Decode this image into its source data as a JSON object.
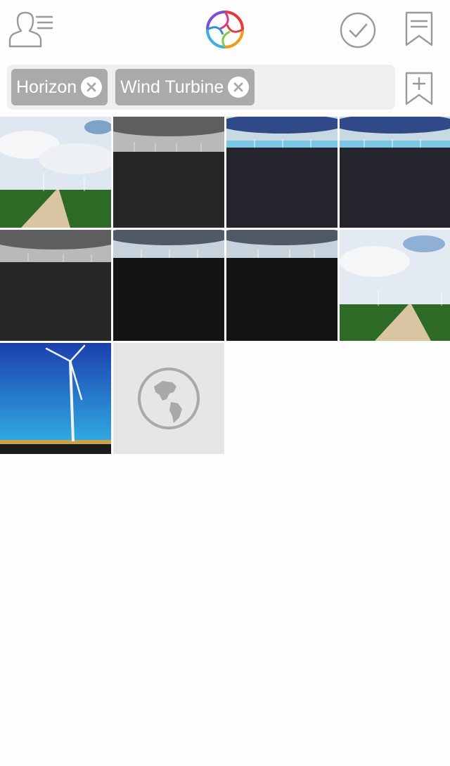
{
  "tags": [
    {
      "label": "Horizon"
    },
    {
      "label": "Wind Turbine"
    }
  ],
  "photos": [
    {
      "scene": "dirt-road-field"
    },
    {
      "scene": "storm-horizon-gray"
    },
    {
      "scene": "blue-sky-horizon"
    },
    {
      "scene": "blue-sky-horizon"
    },
    {
      "scene": "storm-horizon-gray"
    },
    {
      "scene": "dark-field-horizon"
    },
    {
      "scene": "dark-field-horizon"
    },
    {
      "scene": "dirt-road-field"
    },
    {
      "scene": "wind-turbine-blue-sky"
    },
    {
      "scene": "globe-placeholder",
      "icon": "globe-icon"
    }
  ],
  "colors": {
    "chip_bg": "#aaaaaa",
    "tagbar_bg": "#efefef",
    "icon_gray": "#9a9a9a",
    "placeholder_bg": "#e6e6e6"
  }
}
